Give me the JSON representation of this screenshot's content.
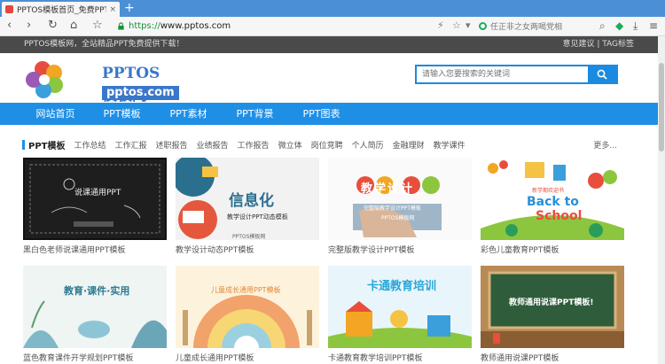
{
  "browser": {
    "tab_title": "PPTOS模板首页_免费PPT模板",
    "tab_close": "×",
    "new_tab": "+",
    "url_scheme": "https://",
    "url_host": "www.pptos.com",
    "search_engine_text": "任正非之女两喝党相",
    "nav_back": "‹",
    "nav_forward": "›",
    "nav_reload": "↻",
    "nav_home": "⌂",
    "nav_star": "☆"
  },
  "site": {
    "welcome": "PPTOS模板网，全站精品PPT免费提供下载！",
    "top_links": "意见建议 | TAG标签",
    "logo_name": "PPTOS模板网",
    "logo_domain": "pptos.com",
    "search_placeholder": "请输入您要搜索的关键词",
    "nav": [
      "网站首页",
      "PPT模板",
      "PPT素材",
      "PPT背景",
      "PPT图表"
    ],
    "category_title": "PPT模板",
    "categories": [
      "工作总结",
      "工作汇报",
      "述职报告",
      "业绩报告",
      "工作报告",
      "微立体",
      "岗位竞聘",
      "个人简历",
      "金融理财",
      "教学课件"
    ],
    "more": "更多...",
    "cards": [
      {
        "caption": "黑白色老师说课通用PPT模板",
        "thumb_text": "说课通用PPT"
      },
      {
        "caption": "教学设计动态PPT模板",
        "thumb_text": "信息化",
        "thumb_sub": "教学设计PPT动态模板",
        "thumb_brand": "PPTOS模板网"
      },
      {
        "caption": "完整版教学设计PPT模板",
        "thumb_text": "教学设计",
        "thumb_sub": "完整版教学设计PPT模板",
        "thumb_brand": "PPTOS模板网"
      },
      {
        "caption": "彩色儿童教育PPT模板",
        "thumb_text": "Back to",
        "thumb_sub": "School",
        "thumb_brand": "新学期欢迎书"
      },
      {
        "caption": "蓝色教育课件开学规划PPT模板",
        "thumb_text": "教育·课件·实用"
      },
      {
        "caption": "儿童成长通用PPT模板",
        "thumb_text": "儿童成长通用PPT模板"
      },
      {
        "caption": "卡通教育教学培训PPT模板",
        "thumb_text": "卡通教育培训"
      },
      {
        "caption": "教师通用说课PPT模板",
        "thumb_text": "教师通用说课PPT模板!"
      }
    ]
  },
  "colors": {
    "accent": "#1f8fe6",
    "topbar": "#4a4a4a",
    "tabstrip": "#4b90d6",
    "logo": "#3a77c9"
  }
}
